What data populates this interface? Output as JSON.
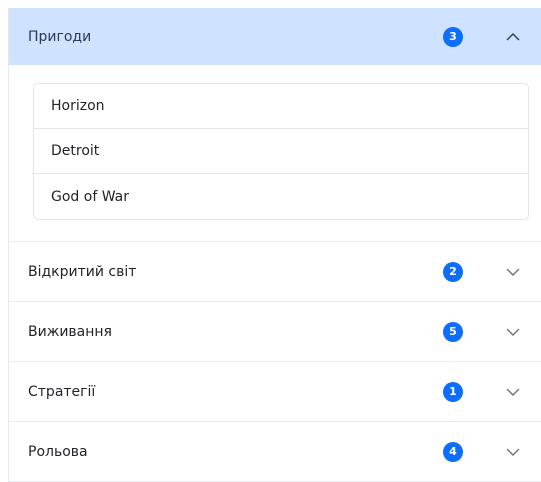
{
  "accordion": {
    "open": {
      "title": "Пригоди",
      "count": "3",
      "items": [
        "Horizon",
        "Detroit",
        "God of War"
      ]
    },
    "sections": [
      {
        "title": "Відкритий світ",
        "count": "2"
      },
      {
        "title": "Виживання",
        "count": "5"
      },
      {
        "title": "Стратегії",
        "count": "1"
      },
      {
        "title": "Рольова",
        "count": "4"
      }
    ]
  },
  "colors": {
    "accent": "#0d6efd",
    "open_header_bg": "#cfe2ff"
  },
  "icons": {
    "open_section": "chevron-up-icon",
    "closed_section": "chevron-down-icon"
  }
}
